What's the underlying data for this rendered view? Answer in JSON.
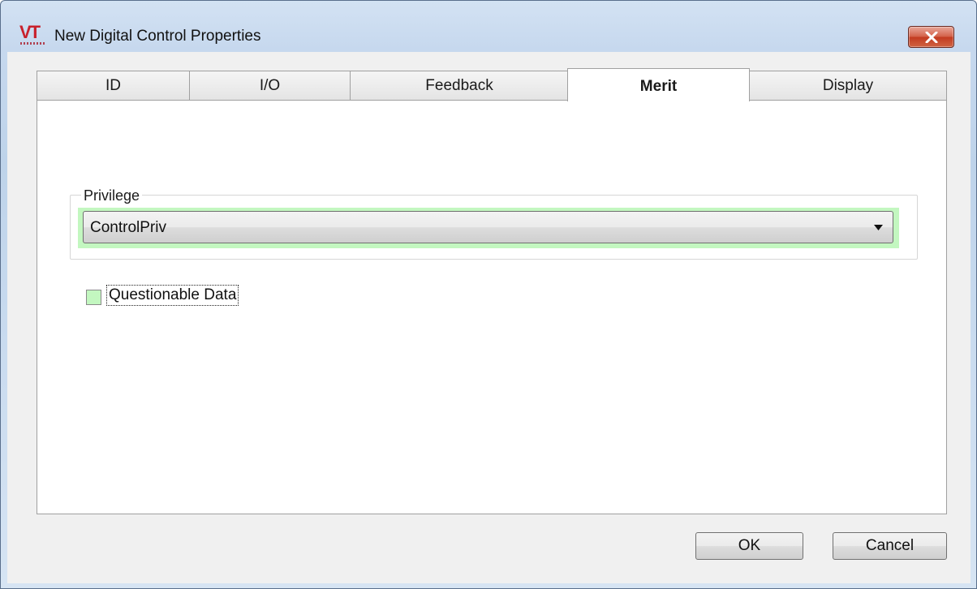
{
  "window": {
    "title": "New Digital Control Properties",
    "app_icon": "vt-logo-icon",
    "app_icon_text": "VT",
    "close_icon": "close-icon"
  },
  "tabs": [
    {
      "label": "ID",
      "active": false
    },
    {
      "label": "I/O",
      "active": false
    },
    {
      "label": "Feedback",
      "active": false
    },
    {
      "label": "Merit",
      "active": true
    },
    {
      "label": "Display",
      "active": false
    }
  ],
  "merit": {
    "privilege_group_label": "Privilege",
    "privilege_value": "ControlPriv",
    "questionable_data_label": "Questionable Data",
    "questionable_data_checked": false
  },
  "buttons": {
    "ok_label": "OK",
    "cancel_label": "Cancel"
  },
  "colors": {
    "highlight_green": "#c3f7c0",
    "close_red": "#c94a2e",
    "titlebar_blue": "#c6d8ee"
  }
}
